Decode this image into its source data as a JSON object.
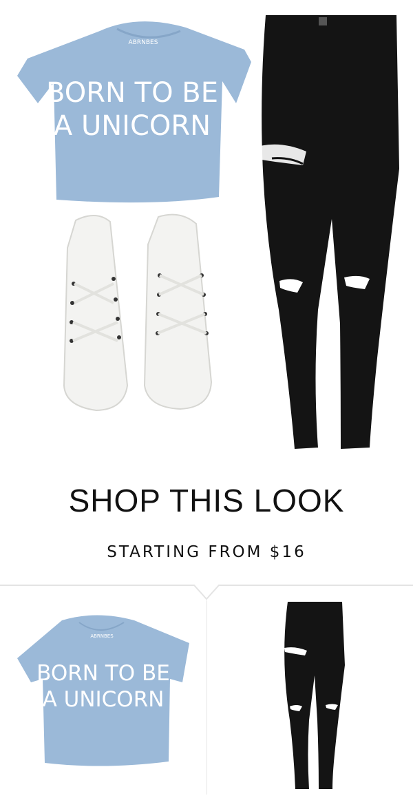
{
  "look": {
    "shirt_line1": "BORN TO BE",
    "shirt_line2": "A UNICORN",
    "shirt_brand": "ABRNBES"
  },
  "shop": {
    "title": "SHOP THIS LOOK",
    "price_label": "STARTING FROM $16"
  },
  "products": [
    {
      "shirt_line1": "BORN TO BE",
      "shirt_line2": "A UNICORN"
    }
  ],
  "colors": {
    "shirt": "#9bb9d8",
    "jeans": "#141414",
    "sneakers": "#f6f6f4"
  }
}
